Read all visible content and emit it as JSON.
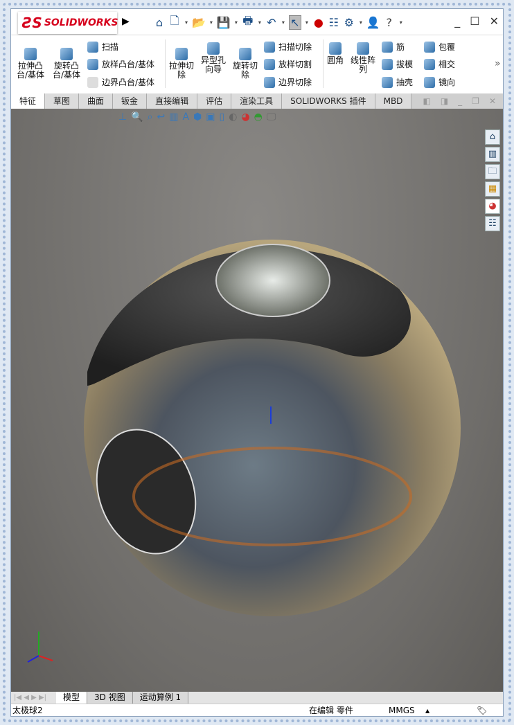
{
  "app": {
    "brand": "SOLIDWORKS",
    "brand_mark": "3S"
  },
  "quick_access": {
    "icons": [
      "home-icon",
      "new-doc-icon",
      "open-icon",
      "save-icon",
      "print-icon",
      "undo-icon",
      "select-icon",
      "rebuild-icon",
      "file-properties-icon",
      "options-icon",
      "user-icon",
      "help-icon"
    ]
  },
  "ribbon": {
    "extrude_boss": "拉伸凸\n台/基体",
    "revolve_boss": "旋转凸\n台/基体",
    "sweep": "扫描",
    "loft": "放样凸台/基体",
    "boundary": "边界凸台/基体",
    "extrude_cut": "拉伸切\n除",
    "hole_wizard": "异型孔\n向导",
    "revolve_cut": "旋转切\n除",
    "swept_cut": "扫描切除",
    "lofted_cut": "放样切割",
    "boundary_cut": "边界切除",
    "fillet": "圆角",
    "linear_pattern": "线性阵\n列",
    "rib": "筋",
    "draft": "拔模",
    "shell": "抽壳",
    "wrap": "包覆",
    "intersect": "相交",
    "mirror": "镜向",
    "more": "»"
  },
  "tabs": [
    "特征",
    "草图",
    "曲面",
    "钣金",
    "直接编辑",
    "评估",
    "渲染工具",
    "SOLIDWORKS 插件",
    "MBD"
  ],
  "bottom_tabs": [
    "模型",
    "3D 视图",
    "运动算例 1"
  ],
  "status": {
    "part_name": "太极球2",
    "mode": "在编辑 零件",
    "units": "MMGS",
    "units_arrow": "▲"
  },
  "colors": {
    "brand": "#d6001c",
    "accent": "#1d4f86"
  }
}
